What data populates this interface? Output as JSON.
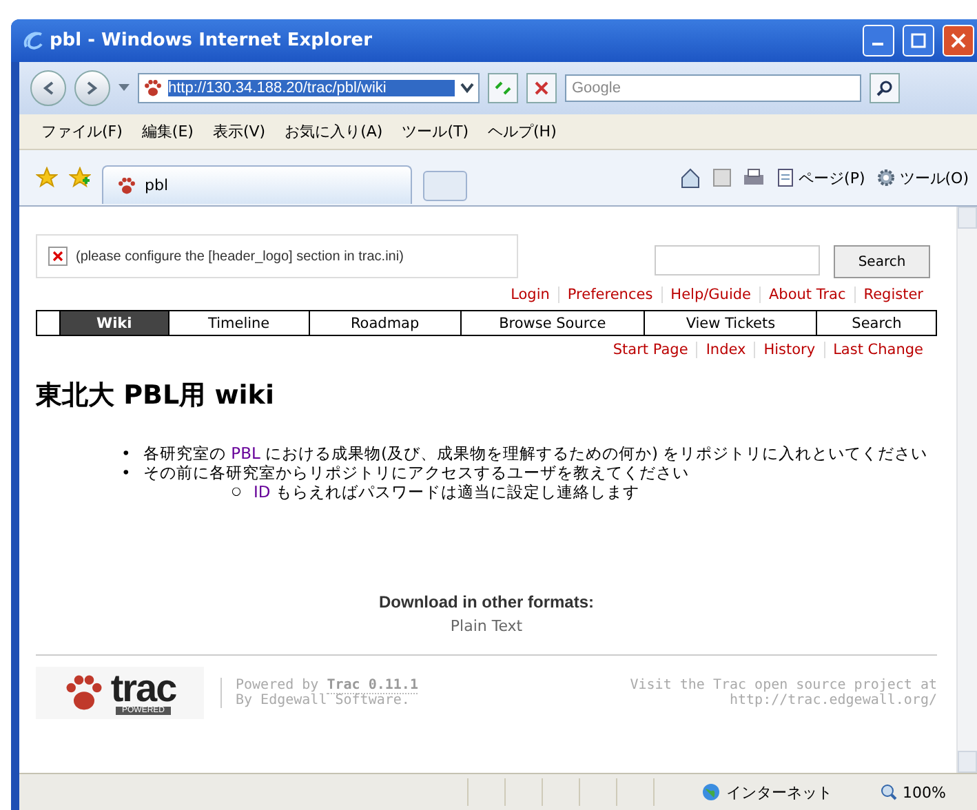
{
  "window": {
    "title": "pbl - Windows Internet Explorer"
  },
  "address_bar": {
    "url": "http://130.34.188.20/trac/pbl/wiki",
    "search_placeholder": "Google"
  },
  "menu": [
    "ファイル(F)",
    "編集(E)",
    "表示(V)",
    "お気に入り(A)",
    "ツール(T)",
    "ヘルプ(H)"
  ],
  "browser_tab": {
    "title": "pbl"
  },
  "command_bar": [
    {
      "kind": "page",
      "label": "ページ(P)"
    },
    {
      "kind": "tools",
      "label": "ツール(O)"
    }
  ],
  "header": {
    "logo_notice": "(please configure the [header_logo] section in trac.ini)",
    "search_button": "Search"
  },
  "meta_nav": [
    "Login",
    "Preferences",
    "Help/Guide",
    "About Trac",
    "Register"
  ],
  "main_nav": [
    {
      "label": "Wiki",
      "selected": true
    },
    {
      "label": "Timeline",
      "selected": false
    },
    {
      "label": "Roadmap",
      "selected": false
    },
    {
      "label": "Browse Source",
      "selected": false
    },
    {
      "label": "View Tickets",
      "selected": false
    },
    {
      "label": "Search",
      "selected": false
    }
  ],
  "context_nav": [
    "Start Page",
    "Index",
    "History",
    "Last Change"
  ],
  "page": {
    "heading": "東北大 PBL用 wiki",
    "items": [
      {
        "marker": "•",
        "parts": [
          {
            "kind": "text",
            "text": "各研究室の "
          },
          {
            "kind": "link",
            "text": "PBL"
          },
          {
            "kind": "text",
            "text": " における成果物(及び、成果物を理解するための何か) をリポジトリに入れといてください"
          }
        ]
      },
      {
        "marker": "•",
        "parts": [
          {
            "kind": "text",
            "text": "その前に各研究室からリポジトリにアクセスするユーザを教えてください"
          }
        ],
        "children": [
          {
            "marker": "○",
            "parts": [
              {
                "kind": "link",
                "text": "ID"
              },
              {
                "kind": "text",
                "text": " もらえればパスワードは適当に設定し連絡します"
              }
            ]
          }
        ]
      }
    ]
  },
  "downloads": {
    "title": "Download in other formats:",
    "links": [
      "Plain Text"
    ]
  },
  "footer": {
    "logo_text": "trac",
    "logo_badge": "POWERED",
    "powered_by": "Powered by ",
    "version_link": "Trac 0.11.1",
    "by": "By Edgewall Software.",
    "visit": "Visit the Trac open source project at",
    "url": "http://trac.edgewall.org/"
  },
  "status_bar": {
    "zone": "インターネット",
    "zoom": "100%"
  }
}
